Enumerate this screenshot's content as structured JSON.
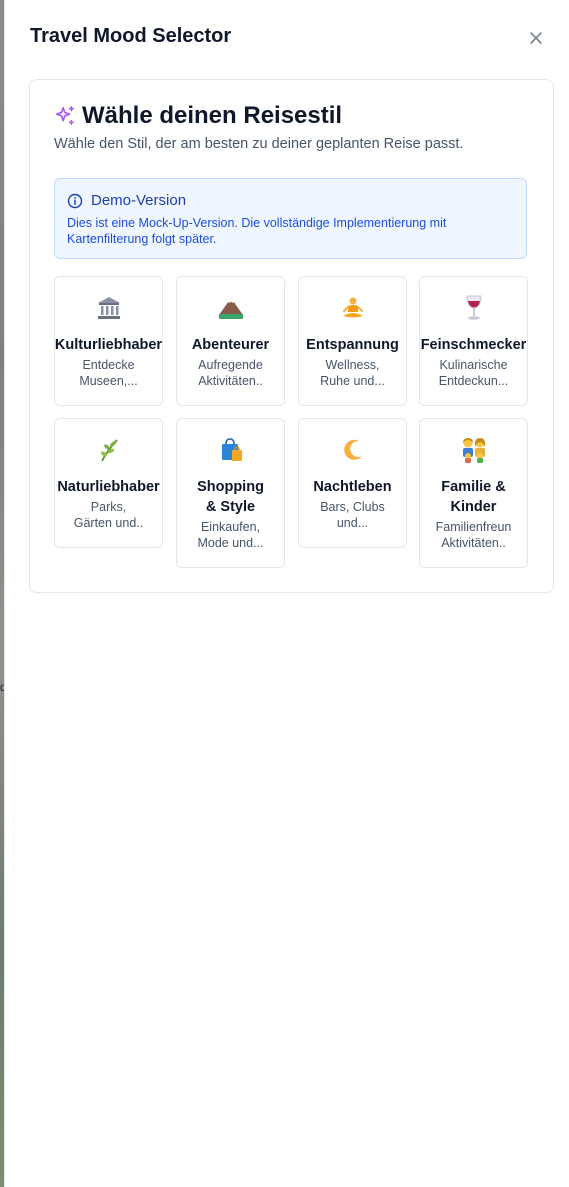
{
  "dialog": {
    "title": "Travel Mood Selector",
    "close_label": "×"
  },
  "background": {
    "partial_letter": "d"
  },
  "card": {
    "title": "Wähle deinen Reisestil",
    "subtitle": "Wähle den Stil, der am besten zu deiner geplanten Reise passt.",
    "icon": "sparkles-icon"
  },
  "demo": {
    "title": "Demo-Version",
    "text": "Dies ist eine Mock-Up-Version. Die vollständige Implementierung mit Kartenfilterung folgt später.",
    "icon": "info-icon"
  },
  "moods": [
    {
      "label": "Kulturliebhaber",
      "desc_line1": "Entdecke",
      "desc_line2": "Museen,...",
      "icon": "museum-icon"
    },
    {
      "label": "Abenteurer",
      "desc_line1": "Aufregende",
      "desc_line2": "Aktivitäten..",
      "icon": "mountain-icon"
    },
    {
      "label": "Entspannung",
      "desc_line1": "Wellness,",
      "desc_line2": "Ruhe und...",
      "icon": "meditation-icon"
    },
    {
      "label": "Feinschmecker",
      "desc_line1": "Kulinarische",
      "desc_line2": "Entdeckun...",
      "icon": "wine-glass-icon"
    },
    {
      "label": "Naturliebhaber",
      "desc_line1": "Parks,",
      "desc_line2": "Gärten und..",
      "icon": "herb-icon"
    },
    {
      "label_line1": "Shopping",
      "label_line2": "& Style",
      "desc_line1": "Einkaufen,",
      "desc_line2": "Mode und...",
      "icon": "shopping-bags-icon"
    },
    {
      "label": "Nachtleben",
      "desc_line1": "Bars, Clubs",
      "desc_line2": "und...",
      "icon": "crescent-moon-icon"
    },
    {
      "label_line1": "Familie &",
      "label_line2": "Kinder",
      "desc_line1": "Familienfreun",
      "desc_line2": "Aktivitäten..",
      "icon": "family-icon"
    }
  ],
  "colors": {
    "accent_purple": "#a855f7",
    "info_blue": "#1e40af",
    "info_bg": "#eff6ff"
  }
}
